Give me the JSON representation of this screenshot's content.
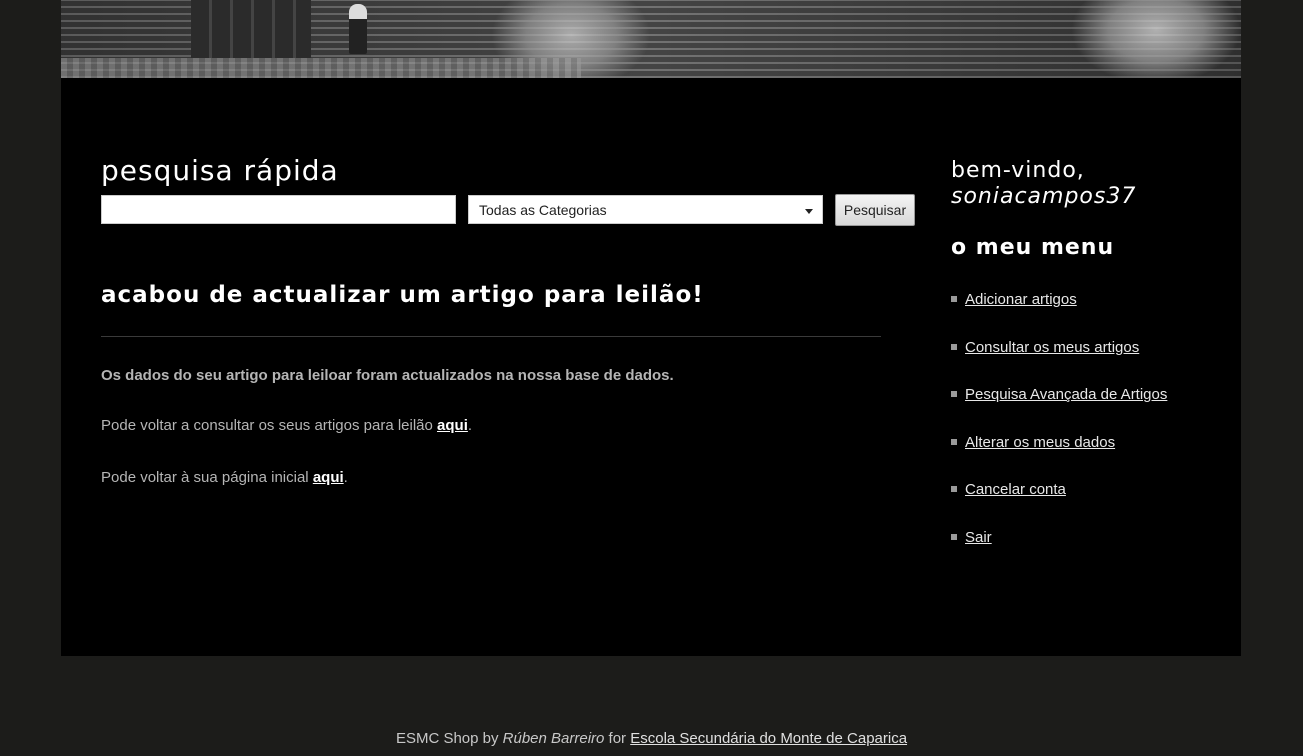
{
  "search": {
    "title": "pesquisa rápida",
    "input_value": "",
    "category_selected": "Todas as Categorias",
    "button_label": "Pesquisar"
  },
  "result": {
    "title": "acabou de actualizar um artigo para leilão!",
    "message": "Os dados do seu artigo para leiloar foram actualizados na nossa base de dados.",
    "line1_text": "Pode voltar a consultar os seus artigos para leilão ",
    "line1_link": "aqui",
    "line2_text": "Pode voltar à sua página inicial ",
    "line2_link": "aqui",
    "period": "."
  },
  "sidebar": {
    "welcome": "bem-vindo,",
    "username": "soniacampos37",
    "menu_title": "o meu menu",
    "items": [
      {
        "label": "Adicionar artigos"
      },
      {
        "label": "Consultar os meus artigos"
      },
      {
        "label": "Pesquisa Avançada de Artigos"
      },
      {
        "label": "Alterar os meus dados"
      },
      {
        "label": "Cancelar conta"
      },
      {
        "label": "Sair"
      }
    ]
  },
  "footer": {
    "shop": "ESMC Shop by ",
    "author": "Rúben Barreiro",
    "for": " for ",
    "school": "Escola Secundária do Monte de Caparica"
  }
}
